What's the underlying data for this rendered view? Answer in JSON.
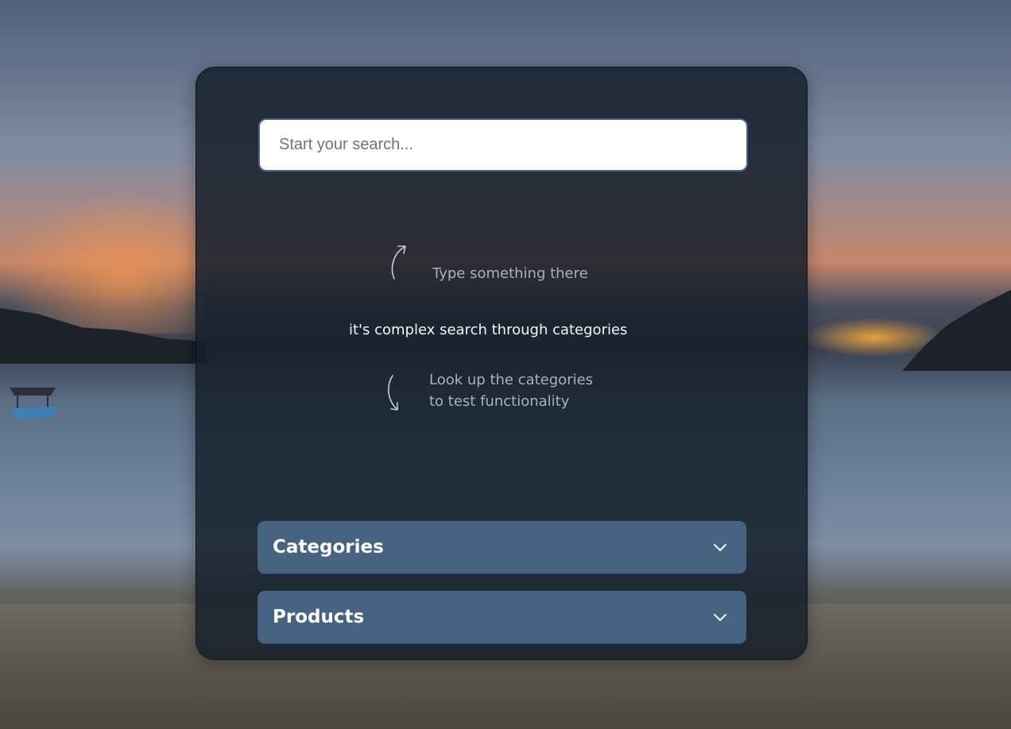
{
  "search": {
    "placeholder": "Start your search..."
  },
  "hints": {
    "top": "Type something there",
    "main": "it's complex search through categories",
    "bottom_line1": "Look up the categories",
    "bottom_line2": "to test functionality"
  },
  "accordions": [
    {
      "title": "Categories",
      "icon": "chevron-down-icon"
    },
    {
      "title": "Products",
      "icon": "chevron-down-icon"
    }
  ],
  "colors": {
    "panel": "#151f2a",
    "accordion": "#466482",
    "hint_text": "#a6b2bf",
    "main_text": "#f2f4f7"
  }
}
